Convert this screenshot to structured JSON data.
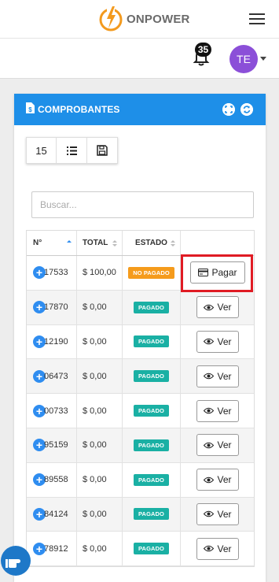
{
  "header": {
    "brand_prefix": "ON",
    "brand_suffix": "POWER",
    "menu_icon": "hamburger-icon",
    "notifications_icon": "bell-icon",
    "notifications_count": "35",
    "avatar_initials": "TE",
    "colors": {
      "brand": "#f39a1e",
      "avatar": "#8b4fd8"
    }
  },
  "card": {
    "title": "COMPROBANTES",
    "title_icon": "document-dollar-icon",
    "header_color": "#1e8fe8",
    "actions": [
      "expand-icon",
      "refresh-icon"
    ]
  },
  "toolbar": {
    "page_size": "15",
    "list_icon": "list-icon",
    "save_icon": "save-icon"
  },
  "search": {
    "placeholder": "Buscar..."
  },
  "table": {
    "columns": [
      "N°",
      "TOTAL",
      "ESTADO",
      ""
    ],
    "rows": [
      {
        "number": "17533",
        "total": "$ 100,00",
        "status": "NO PAGADO",
        "action": "Pagar"
      },
      {
        "number": "17870",
        "total": "$ 0,00",
        "status": "PAGADO",
        "action": "Ver"
      },
      {
        "number": "12190",
        "total": "$ 0,00",
        "status": "PAGADO",
        "action": "Ver"
      },
      {
        "number": "06473",
        "total": "$ 0,00",
        "status": "PAGADO",
        "action": "Ver"
      },
      {
        "number": "00733",
        "total": "$ 0,00",
        "status": "PAGADO",
        "action": "Ver"
      },
      {
        "number": "95159",
        "total": "$ 0,00",
        "status": "PAGADO",
        "action": "Ver"
      },
      {
        "number": "89558",
        "total": "$ 0,00",
        "status": "PAGADO",
        "action": "Ver"
      },
      {
        "number": "84124",
        "total": "$ 0,00",
        "status": "PAGADO",
        "action": "Ver"
      },
      {
        "number": "78912",
        "total": "$ 0,00",
        "status": "PAGADO",
        "action": "Ver"
      }
    ],
    "status_colors": {
      "PAGADO": "#1ab0a4",
      "NO PAGADO": "#f59b1c"
    }
  },
  "fab_icon": "pointing-hand-icon"
}
